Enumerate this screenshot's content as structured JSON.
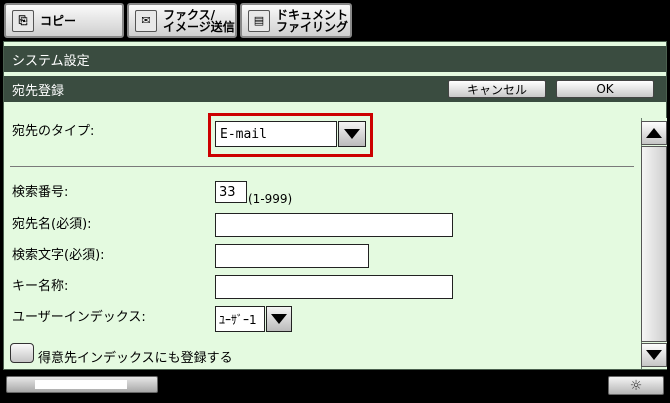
{
  "tabs": [
    {
      "line1": "コピー",
      "line2": ""
    },
    {
      "line1": "ファクス/",
      "line2": "イメージ送信"
    },
    {
      "line1": "ドキュメント",
      "line2": "ファイリング"
    }
  ],
  "header": {
    "title": "システム設定"
  },
  "subheader": {
    "title": "宛先登録",
    "cancel_label": "キャンセル",
    "ok_label": "OK"
  },
  "form": {
    "dest_type_label": "宛先のタイプ:",
    "dest_type_value": "E-mail",
    "search_no_label": "検索番号:",
    "search_no_value": "33",
    "search_no_range": "(1-999)",
    "dest_name_label": "宛先名(必須):",
    "search_char_label": "検索文字(必須):",
    "key_name_label": "キー名称:",
    "user_index_label": "ユーザーインデックス:",
    "user_index_value": "ﾕｰｻﾞｰ1",
    "favorite_label": "得意先インデックスにも登録する"
  },
  "colors": {
    "highlight": "#cc0000",
    "panel_bg": "#e4fae0",
    "bar_bg": "#3a4c40"
  }
}
